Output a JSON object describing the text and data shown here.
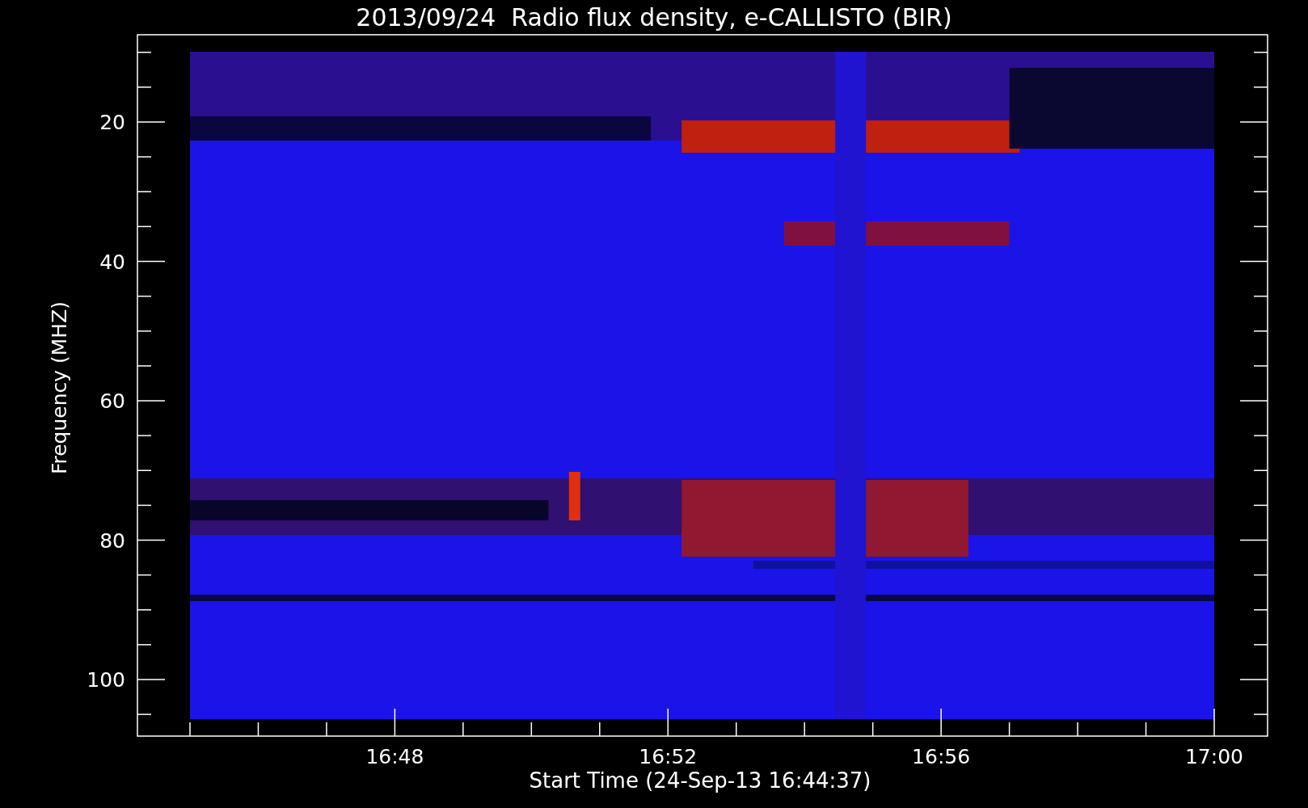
{
  "title": "2013/09/24  Radio flux density, e-CALLISTO (BIR)",
  "ylabel": "Frequency (MHZ)",
  "xlabel": "Start Time (24-Sep-13 16:44:37)",
  "yticks": [
    "20",
    "40",
    "60",
    "80",
    "100"
  ],
  "xticks": [
    "16:48",
    "16:52",
    "16:56",
    "17:00"
  ]
}
